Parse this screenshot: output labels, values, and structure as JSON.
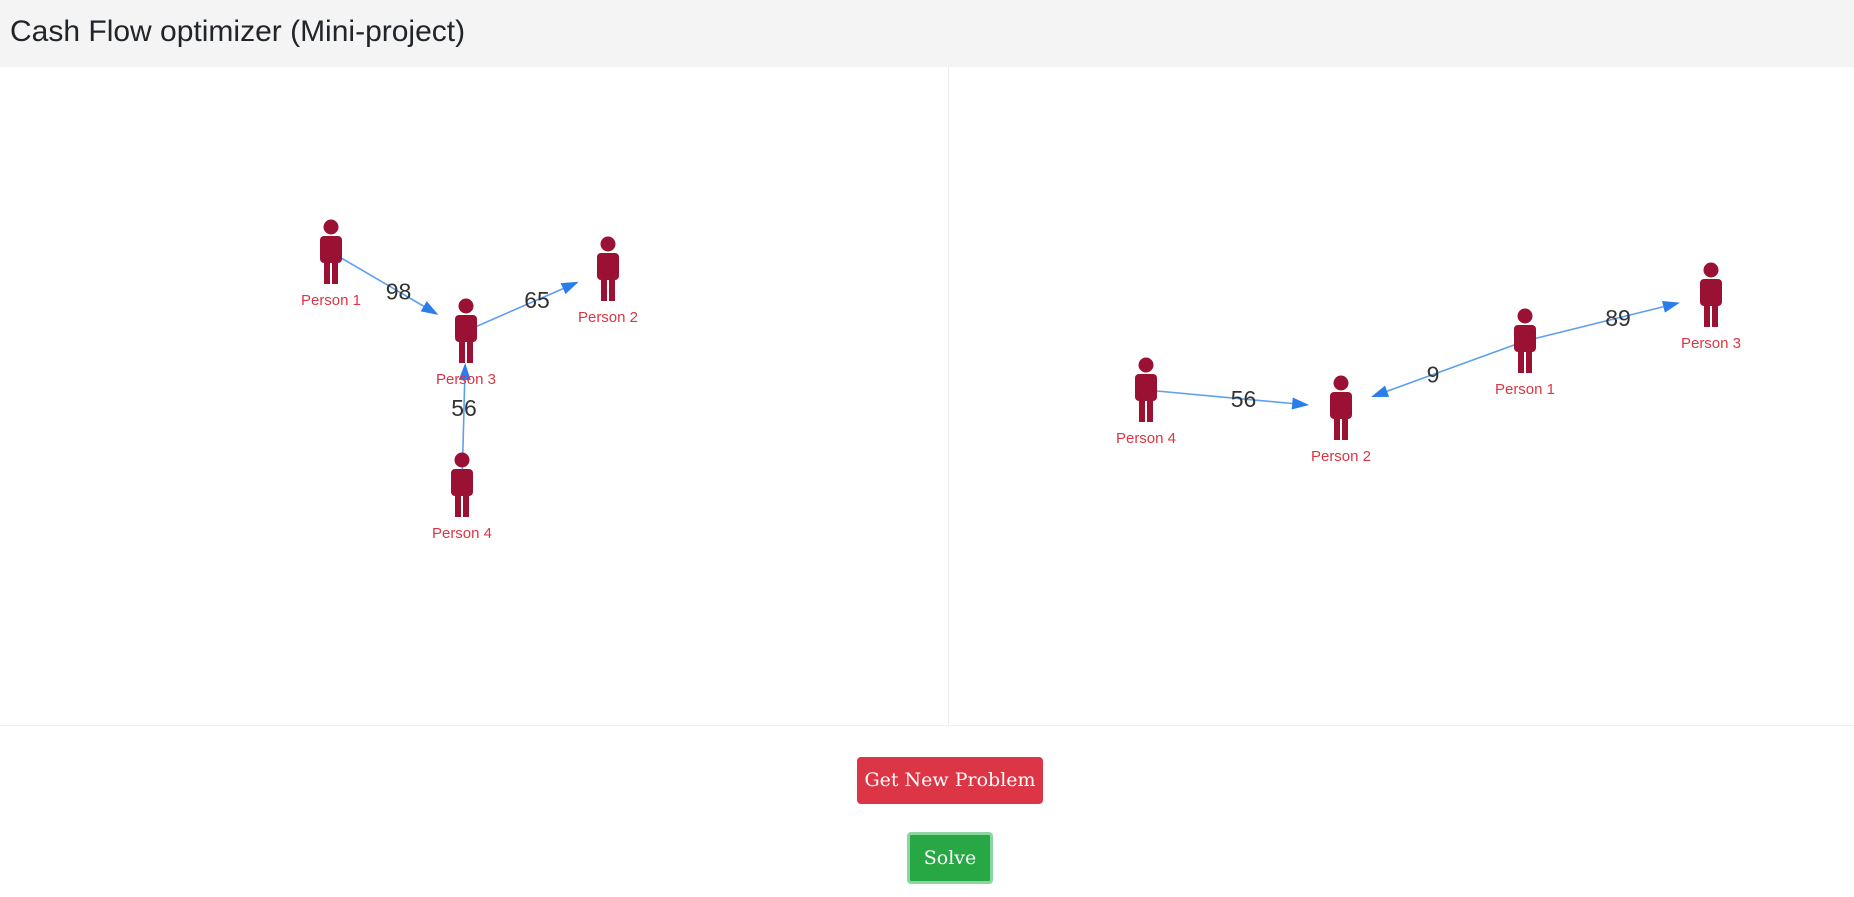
{
  "page": {
    "title": "Cash Flow optimizer (Mini-project)"
  },
  "colors": {
    "header_bg": "#f4f4f4",
    "person_icon": "#9b1134",
    "node_label": "#dc3545",
    "edge": "#5e9ff0",
    "arrow": "#2b7de9",
    "danger_button": "#dc3545",
    "success_button": "#28a745"
  },
  "graphs": [
    {
      "id": "problem",
      "nodes": [
        {
          "id": "p1",
          "label": "Person 1",
          "icon": "person-icon"
        },
        {
          "id": "p2",
          "label": "Person 2",
          "icon": "person-icon"
        },
        {
          "id": "p3",
          "label": "Person 3",
          "icon": "person-icon"
        },
        {
          "id": "p4",
          "label": "Person 4",
          "icon": "person-icon"
        }
      ],
      "edges": [
        {
          "from": "p1",
          "to": "p3",
          "amount": "98"
        },
        {
          "from": "p3",
          "to": "p2",
          "amount": "65"
        },
        {
          "from": "p4",
          "to": "p3",
          "amount": "56"
        }
      ]
    },
    {
      "id": "solution",
      "nodes": [
        {
          "id": "p1",
          "label": "Person 1",
          "icon": "person-icon"
        },
        {
          "id": "p2",
          "label": "Person 2",
          "icon": "person-icon"
        },
        {
          "id": "p3",
          "label": "Person 3",
          "icon": "person-icon"
        },
        {
          "id": "p4",
          "label": "Person 4",
          "icon": "person-icon"
        }
      ],
      "edges": [
        {
          "from": "p4",
          "to": "p2",
          "amount": "56"
        },
        {
          "from": "p1",
          "to": "p2",
          "amount": "9"
        },
        {
          "from": "p1",
          "to": "p3",
          "amount": "89"
        }
      ]
    }
  ],
  "buttons": {
    "new_problem": "Get New Problem",
    "solve": "Solve"
  }
}
